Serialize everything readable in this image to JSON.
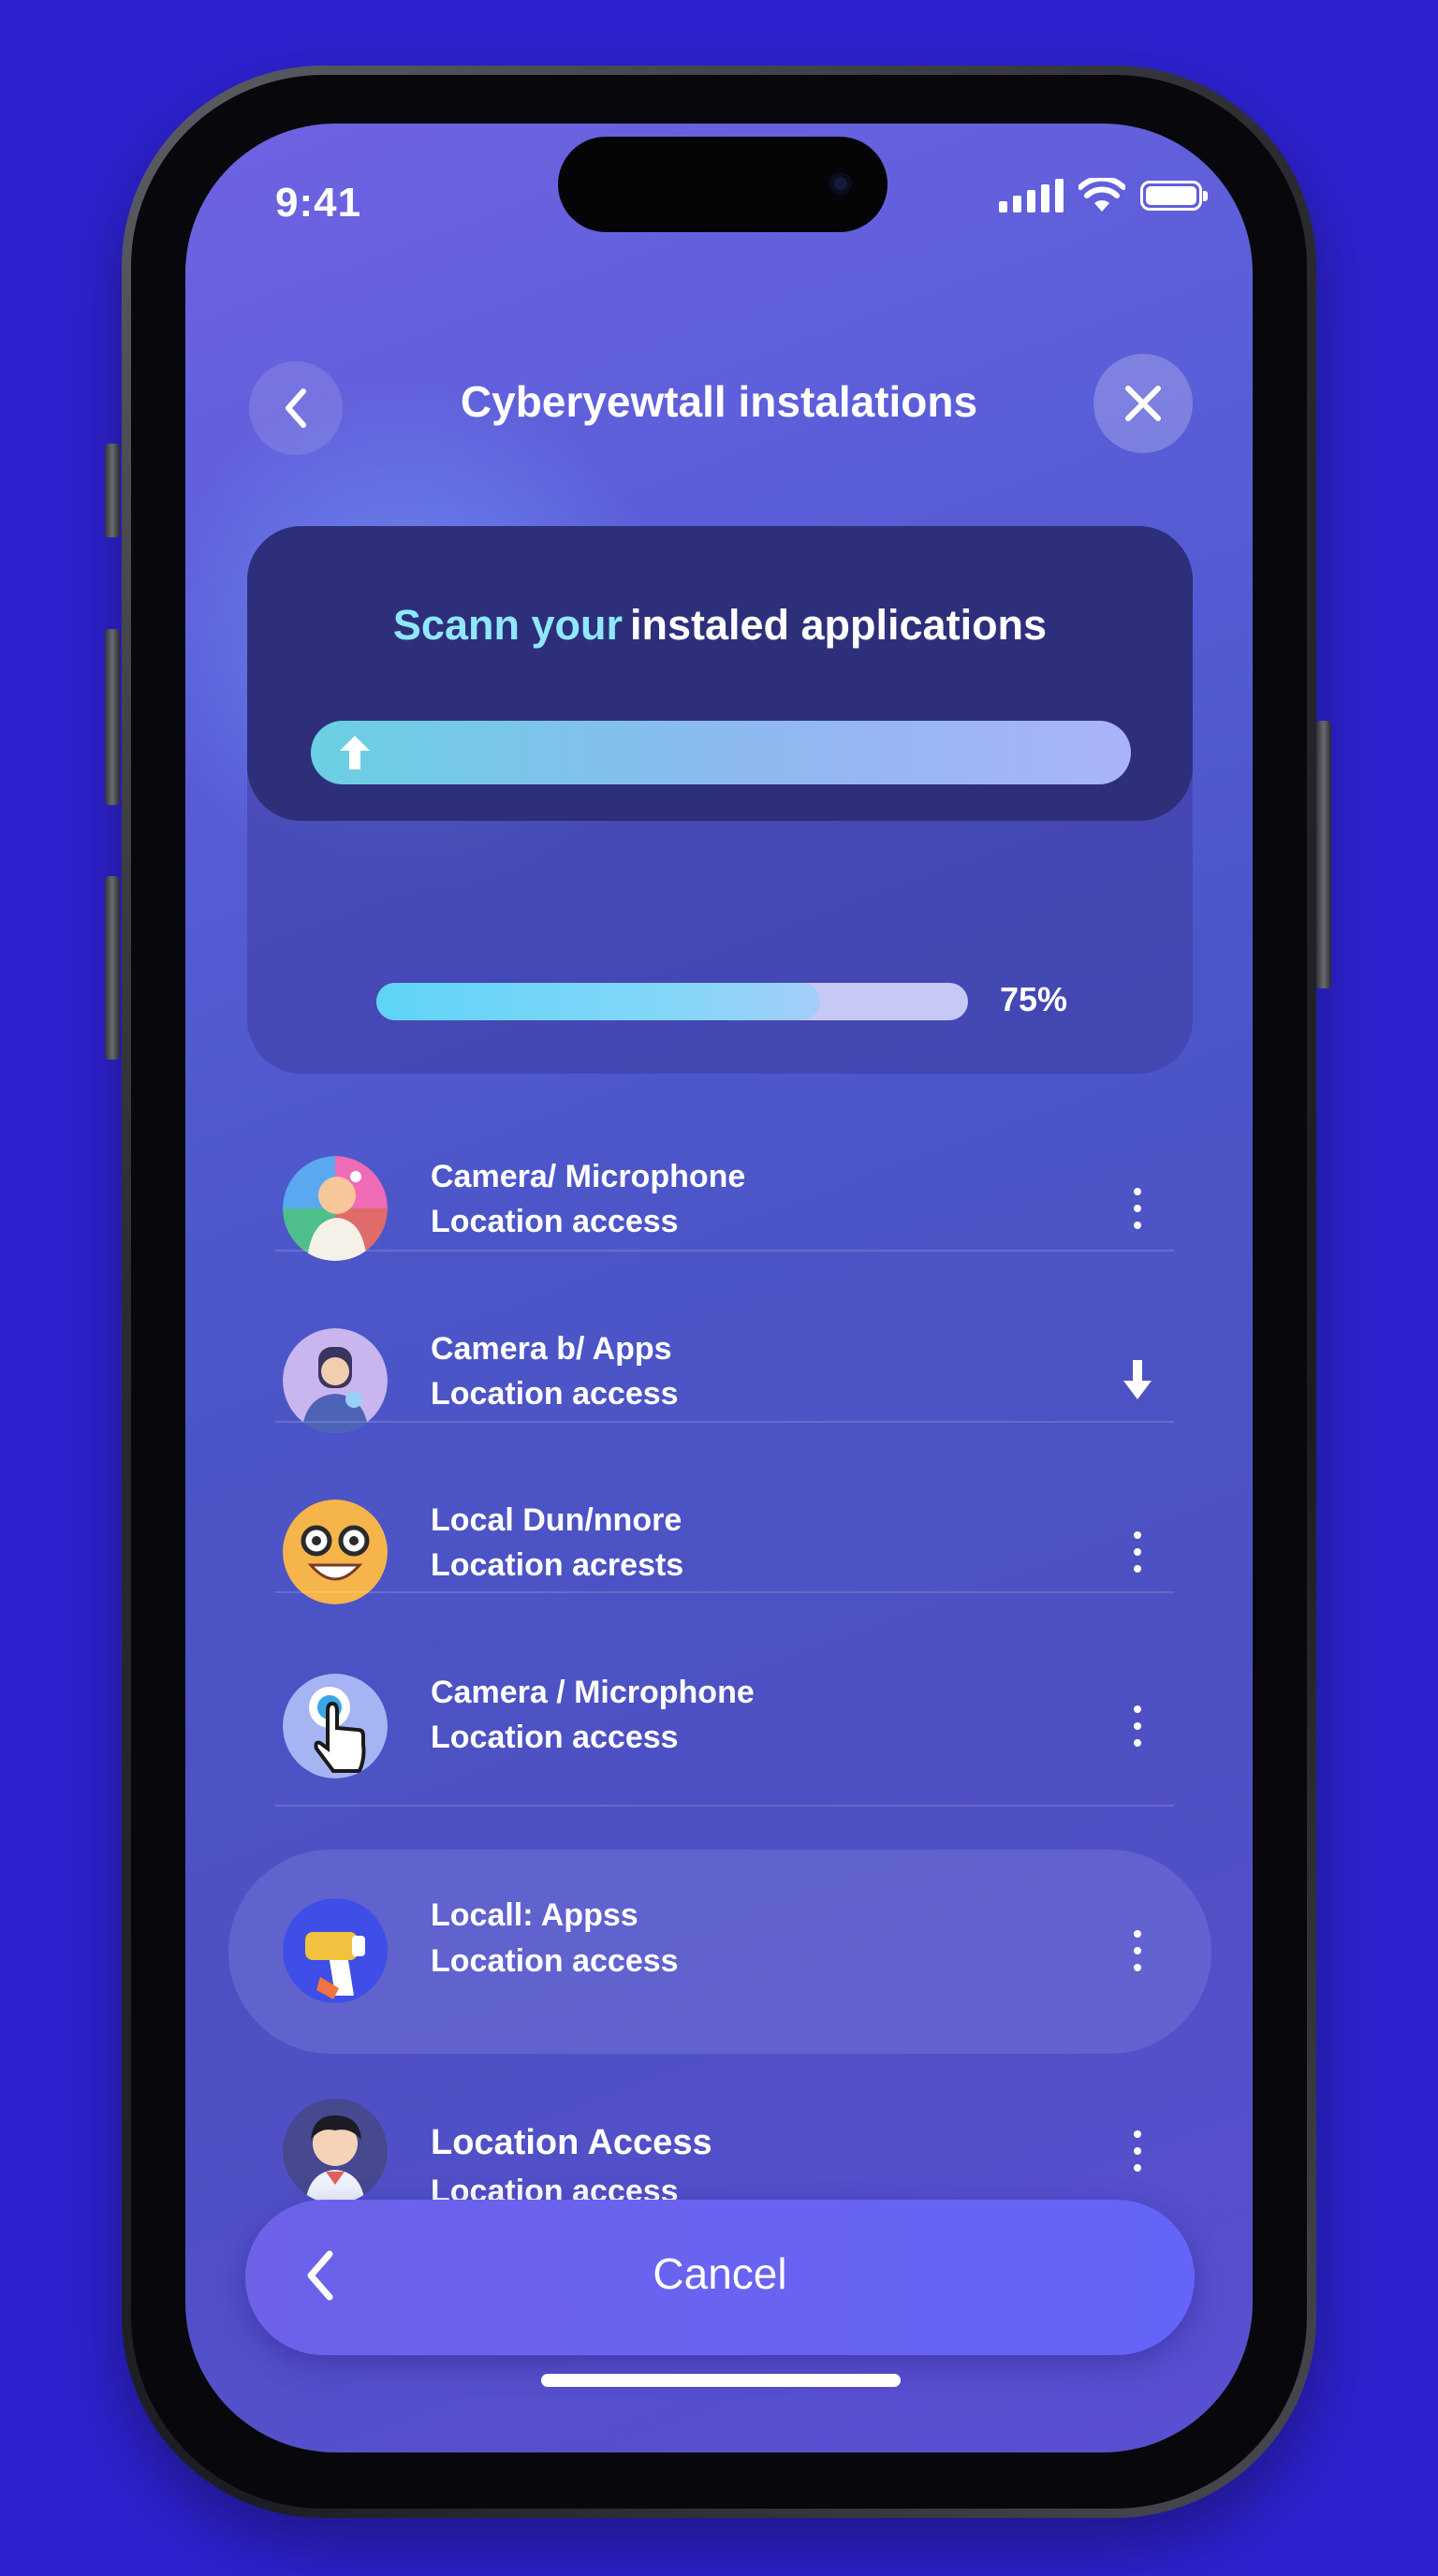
{
  "status_bar": {
    "time": "9:41"
  },
  "nav": {
    "title": "Cyberyewtall instalations"
  },
  "scan_card": {
    "title_highlight": "Scann your",
    "title_rest": "instaled applications",
    "progress_percent": 75,
    "progress_label": "75%",
    "carousel_dots": 2,
    "active_dot": 0
  },
  "items": [
    {
      "title": "Camera/ Microphone",
      "subtitle": "Location access",
      "action_icon": "kebab-icon"
    },
    {
      "title": "Camera b/ Apps",
      "subtitle": "Location access",
      "action_icon": "download-arrow-icon"
    },
    {
      "title": "Local Dun/nnore",
      "subtitle": "Location acrests",
      "action_icon": "kebab-icon"
    },
    {
      "title": "Camera / Microphone",
      "subtitle": "Location access",
      "action_icon": "kebab-icon"
    },
    {
      "title": "Locall: Appss",
      "subtitle": "Location access",
      "action_icon": "kebab-icon"
    },
    {
      "title": "Location Access",
      "subtitle": "Location access",
      "action_icon": "kebab-icon"
    }
  ],
  "bottom_bar": {
    "cancel_label": "Cancel"
  },
  "colors": {
    "background": "#2d22cf",
    "accent_cyan": "#8fe8ff",
    "card_dark": "#2e2f7b",
    "button": "#6464f8"
  }
}
